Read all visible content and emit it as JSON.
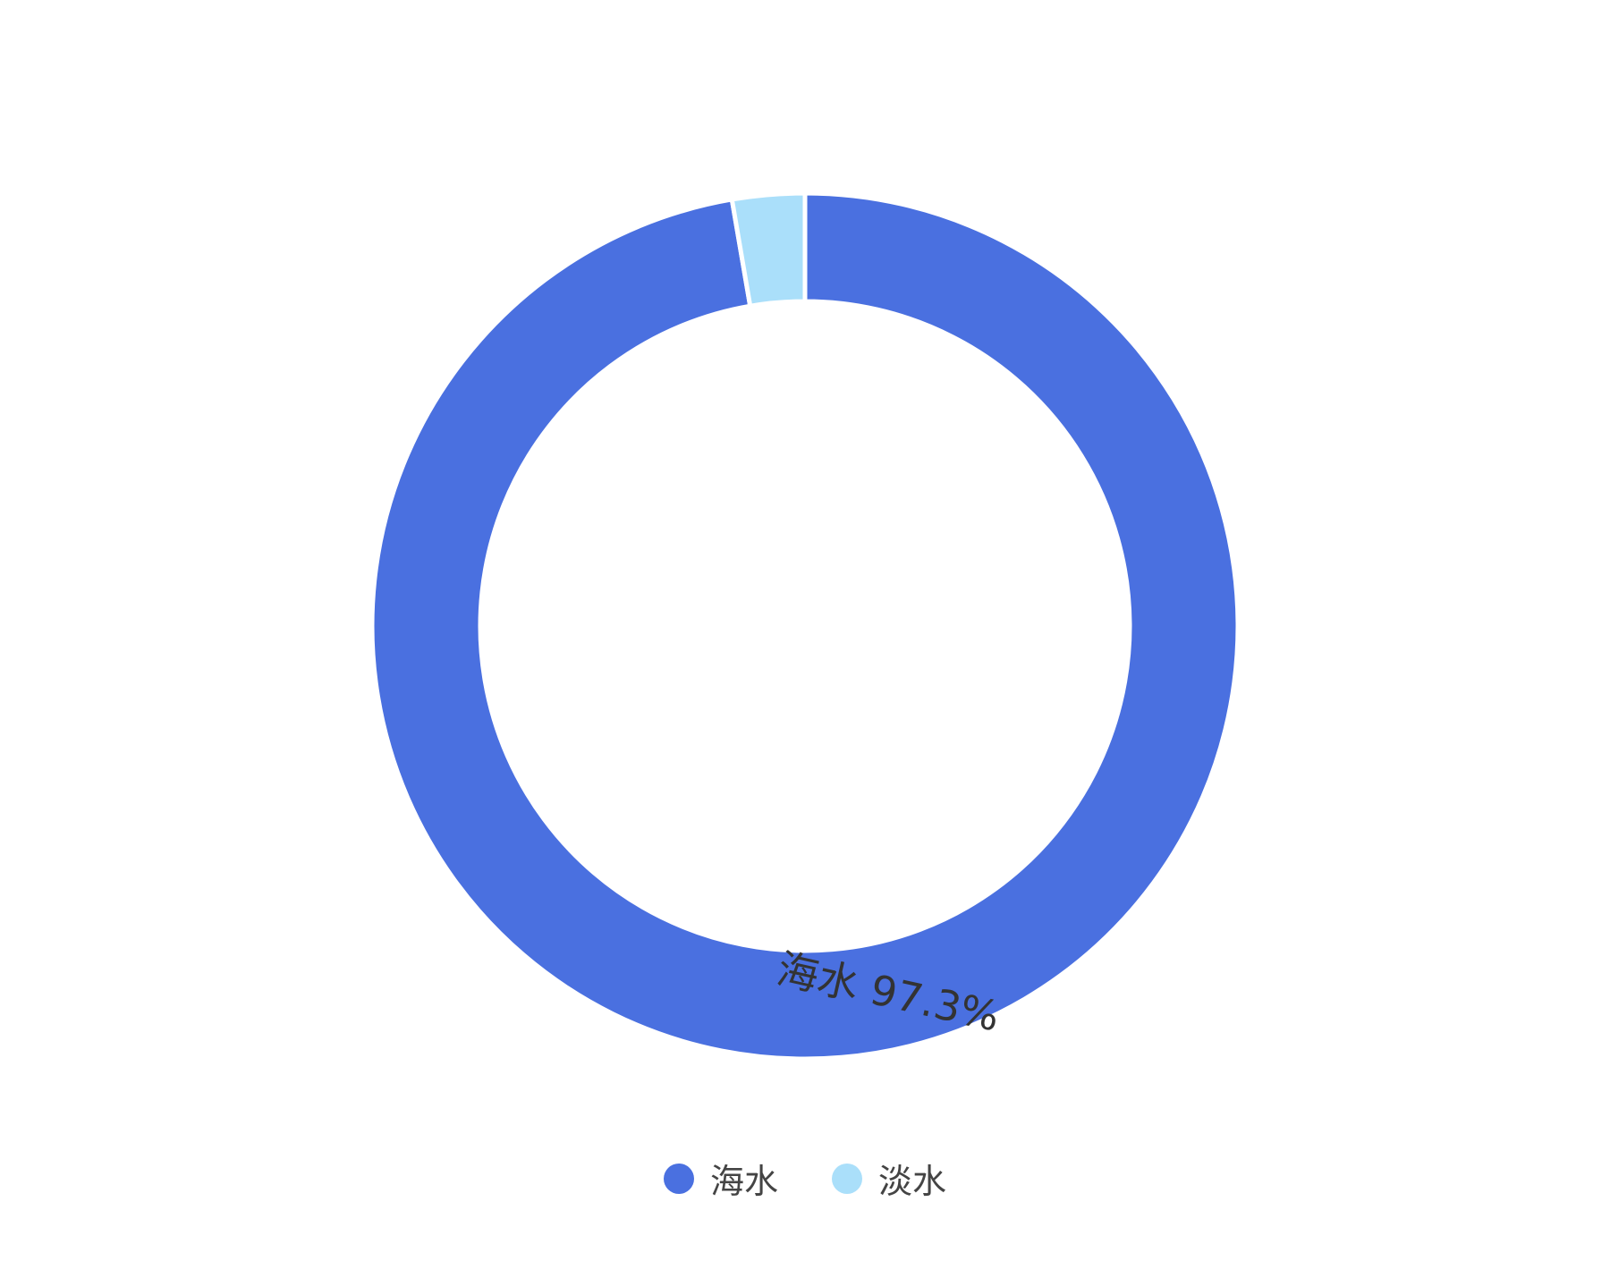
{
  "chart_data": {
    "type": "pie",
    "variant": "donut",
    "title": "",
    "categories": [
      "海水",
      "淡水"
    ],
    "values": [
      97.3,
      2.7
    ],
    "unit": "%",
    "colors": [
      "#4a70e0",
      "#aadffa"
    ],
    "data_labels": [
      {
        "category": "海水",
        "text": "海水  97.3%"
      }
    ],
    "legend": {
      "position": "bottom",
      "items": [
        {
          "label": "海水",
          "color": "#4a70e0"
        },
        {
          "label": "淡水",
          "color": "#aadffa"
        }
      ]
    }
  }
}
